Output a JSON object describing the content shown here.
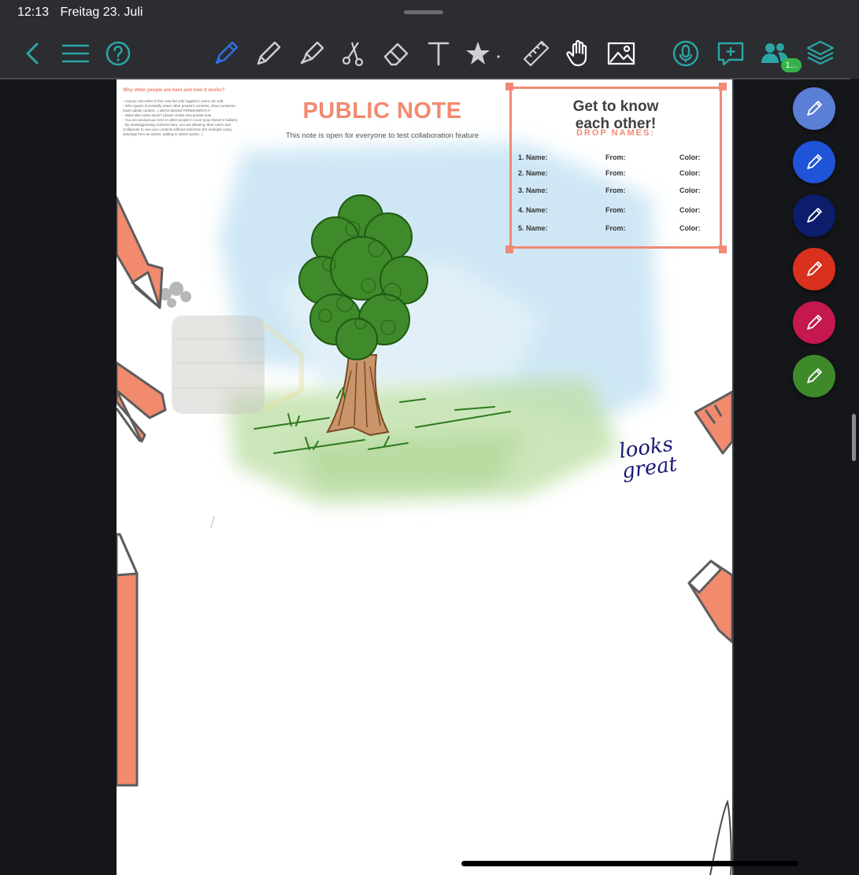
{
  "status_bar": {
    "time": "12:13",
    "date": "Freitag 23. Juli"
  },
  "toolbar": {
    "left": [
      {
        "name": "back-chevron-icon"
      },
      {
        "name": "menu-icon"
      },
      {
        "name": "help-icon"
      }
    ],
    "tools": [
      {
        "name": "fountain-pen-icon",
        "active": true
      },
      {
        "name": "pencil-icon"
      },
      {
        "name": "highlighter-icon"
      },
      {
        "name": "scissors-icon"
      },
      {
        "name": "eraser-icon"
      },
      {
        "name": "text-tool-icon",
        "glyph": "T"
      },
      {
        "name": "star-icon"
      },
      {
        "name": "dot-separator"
      },
      {
        "name": "ruler-icon"
      },
      {
        "name": "hand-icon"
      },
      {
        "name": "image-icon"
      }
    ],
    "right": [
      {
        "name": "microphone-icon"
      },
      {
        "name": "add-comment-icon"
      },
      {
        "name": "users-icon"
      },
      {
        "name": "layers-icon"
      }
    ],
    "users_badge": "1..."
  },
  "note": {
    "info_title": "Why other people are here and how it works?",
    "info_text": "- Anyone can write! in this note but only logged in users can edit.\n- Who spams (constantly erase other people's contents, draw nonsense, insert adults content...) will be banned PERMANENTLY!\n- Want take notes alone? please create new private note\n- You are anonymous here to other people in room (your friend is hidden).\n- By drawing/posting contents here, you are allowing other users and Collabnote to use your contents without restriction (for example using drawings here as sticker, adding to sticker packs...)",
    "title": "PUBLIC NOTE",
    "subtitle": "This note is open for everyone to test collaboration feature"
  },
  "get_to_know": {
    "title": "Get to know\neach other!",
    "drop_names": "DROP NAMES:",
    "rows": [
      {
        "name": "1. Name:",
        "from": "From:",
        "color": "Color:"
      },
      {
        "name": "2. Name:",
        "from": "From:",
        "color": "Color:"
      },
      {
        "name": "3. Name:",
        "from": "From:",
        "color": "Color:"
      },
      {
        "name": "4. Name:",
        "from": "From:",
        "color": "Color:"
      },
      {
        "name": "5. Name:",
        "from": "From:",
        "color": "Color:"
      }
    ]
  },
  "handwriting": "looks\ngreat",
  "pen_presets": [
    {
      "name": "pen-preset-light-blue",
      "color": "#5b7ed6"
    },
    {
      "name": "pen-preset-blue",
      "color": "#1f54d9"
    },
    {
      "name": "pen-preset-navy",
      "color": "#0b1d6b"
    },
    {
      "name": "pen-preset-red",
      "color": "#d8311d"
    },
    {
      "name": "pen-preset-magenta",
      "color": "#c4184f"
    },
    {
      "name": "pen-preset-green",
      "color": "#3e8a2a"
    }
  ],
  "colors": {
    "accent": "#2aa6a6",
    "active_tool": "#2f6fe3",
    "toolbar_bg": "#2c2d31",
    "salmon": "#f28a6e"
  }
}
